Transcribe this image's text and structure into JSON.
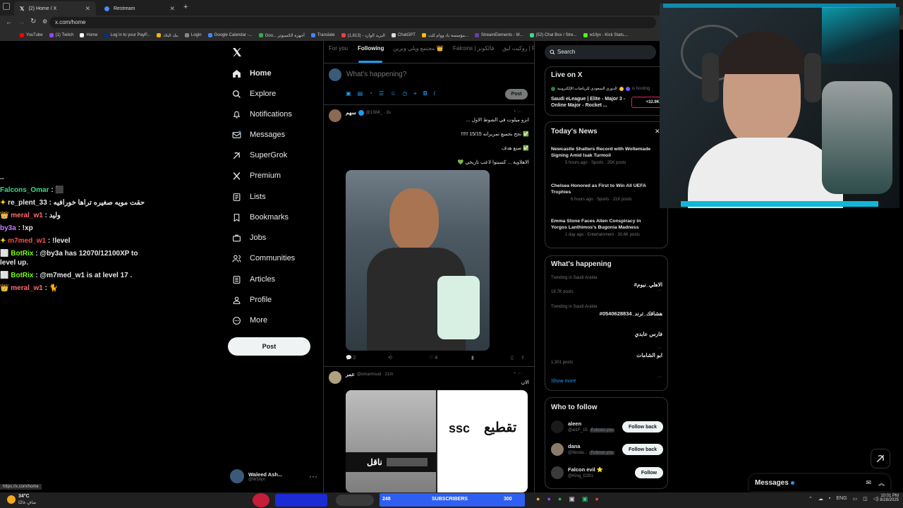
{
  "browser": {
    "tabs": [
      {
        "label": "(2) Home / X",
        "active": true
      },
      {
        "label": "Restream",
        "active": false
      }
    ],
    "url": "x.com/home",
    "bookmarks": [
      "YouTube",
      "(1) Twitch",
      "Home",
      "Log in to your PayP...",
      "بنك البلاد",
      "Login",
      "Google Calendar -...",
      "Goo... أجهزة الكمبيوتر",
      "Translate",
      "البريد الوارد - (1,813)",
      "ChatGPT",
      "مؤسسة باد ووام للت...",
      "StreamElements - M...",
      "(52) Chat Box / Stre...",
      "w1llyv - Kick Stats,..."
    ],
    "status_url": "https://x.com/home"
  },
  "chat": [
    {
      "user": "",
      "text": "..",
      "color": "#e7e9ea"
    },
    {
      "user": "Falcons_Omar",
      "text": ": ⬛",
      "color": "#3ddc84"
    },
    {
      "user": "re_plent_33",
      "text": ": حقت مويه صغيره تراها خورافيه",
      "color": "#e7e9ea",
      "badge": "✦"
    },
    {
      "user": "meral_w1",
      "text": ": وليد",
      "color": "#ff6b6b",
      "badge": "👑"
    },
    {
      "user": "by3a",
      "text": ": !xp",
      "color": "#c77dff"
    },
    {
      "user": "m7med_w1",
      "text": ": !level",
      "color": "#ff4d4d",
      "badge": "✦"
    },
    {
      "user": "BotRix",
      "text": ": @by3a has 12070/12100XP to level up.",
      "color": "#7cfc00",
      "badge": "⬜"
    },
    {
      "user": "BotRix",
      "text": ": @m7med_w1 is at level 17 .",
      "color": "#7cfc00",
      "badge": "⬜"
    },
    {
      "user": "meral_w1",
      "text": ": 🐈",
      "color": "#ff6b6b",
      "badge": "👑"
    }
  ],
  "nav": {
    "items": [
      "Home",
      "Explore",
      "Notifications",
      "Messages",
      "SuperGrok",
      "Premium",
      "Lists",
      "Bookmarks",
      "Jobs",
      "Communities",
      "Articles",
      "Profile",
      "More"
    ],
    "post": "Post",
    "account_name": "Waleed Ash...",
    "account_handle": "@W1llyv"
  },
  "feed": {
    "tabs": [
      "For you",
      "Following",
      "مجتمع ويلي وبرين 👑",
      "Falcons | فالكونز",
      "روكيت ليق | RL"
    ],
    "compose_placeholder": "What's happening?",
    "compose_post": "Post",
    "tweet1": {
      "name": "سهم",
      "handle": "@1SMI_ · 3s",
      "lines": [
        "انزو ميلوت في الشوط الاول ...",
        "✅ تجح بجميع تمريراته 15/15 !!!!!",
        "✅ صنع هدف",
        "الاهلاوية ... كسبتوا لاعب تاريخي 💚"
      ],
      "replies": "2",
      "likes": "4"
    },
    "tweet2": {
      "name": "عمر",
      "handle": "@omarmsod · 21m",
      "text": "الان",
      "image_text_a": "تقطيع",
      "image_text_b": "ssc",
      "image_text_c": "ناقل"
    }
  },
  "right": {
    "search": "Search",
    "live": {
      "title": "Live on X",
      "host": "الدوري السعودي للرياضات الإلكترونية",
      "status": "is hosting",
      "event": "Saudi eLeague | Elite - Major 3 - Online Major - Rocket ...",
      "count": "+32.9K"
    },
    "news": {
      "title": "Today's News",
      "items": [
        {
          "headline": "Newcastle Shatters Record with Woltemade Signing Amid Isak Turmoil",
          "meta": "5 hours ago · Sports · 25K posts"
        },
        {
          "headline": "Chelsea Honored as First to Win All UEFA Trophies",
          "meta": "6 hours ago · Sports · 21K posts"
        },
        {
          "headline": "Emma Stone Faces Alien Conspiracy in Yorgos Lanthimos's Bugonia Madness",
          "meta": "1 day ago · Entertainment · 30.6K posts"
        }
      ]
    },
    "happening": {
      "title": "What's happening",
      "items": [
        {
          "context": "Trending in Saudi Arabia",
          "topic": "#الاهلي_نيوم",
          "meta": "19.7K posts"
        },
        {
          "context": "Trending in Saudi Arabia",
          "topic": "#هشاقك_ترند_0540628834",
          "meta": ""
        },
        {
          "context": "",
          "topic": "فارس عابدي",
          "meta": ""
        },
        {
          "context": "",
          "topic": "ابو الشامات",
          "meta": "1,301 posts"
        }
      ],
      "show_more": "Show more"
    },
    "follow": {
      "title": "Who to follow",
      "items": [
        {
          "name": "aleen",
          "handle": "@al1F_15",
          "tag": "Follows you",
          "button": "Follow back"
        },
        {
          "name": "dana",
          "handle": "@Ileoda...",
          "tag": "Follows you",
          "button": "Follow back"
        },
        {
          "name": "Falcon evil ⭐",
          "handle": "@King_D281",
          "tag": "",
          "button": "Follow"
        }
      ]
    },
    "messages": "Messages"
  },
  "taskbar": {
    "weather": "34°C",
    "weather_sub": "صافٍ غالبًا",
    "lang": "ENG",
    "time": "10:01 PM",
    "date": "8/28/2025",
    "subs_count": "248",
    "subs_label": "SUBSCRIBERS",
    "subs_goal": "300"
  }
}
